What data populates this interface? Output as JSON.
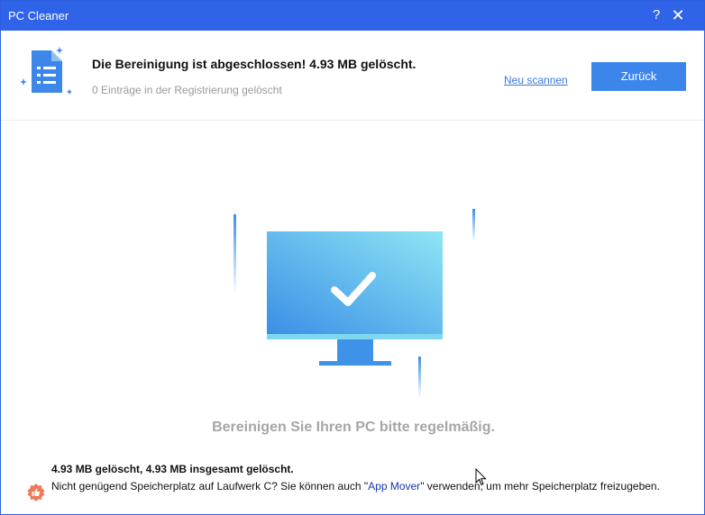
{
  "window": {
    "title": "PC Cleaner",
    "help_glyph": "?",
    "close_glyph": "✕"
  },
  "header": {
    "headline": "Die Bereinigung ist abgeschlossen! 4.93 MB gelöscht.",
    "subline": "0 Einträge in der Registrierung gelöscht",
    "rescan_label": "Neu scannen",
    "back_label": "Zurück",
    "icon": "document-sparkle-icon"
  },
  "main": {
    "illustration": "monitor-checkmark-icon",
    "hint": "Bereinigen Sie Ihren PC bitte regelmäßig."
  },
  "footer": {
    "summary": "4.93 MB gelöscht, 4.93 MB insgesamt gelöscht.",
    "notice_before": "Nicht genügend Speicherplatz auf Laufwerk C? Sie können auch \"",
    "notice_link": "App Mover",
    "notice_after": "\" verwenden, um mehr Speicherplatz freizugeben.",
    "icon": "thumbs-up-badge-icon"
  },
  "colors": {
    "titlebar": "#2f63e8",
    "accent_button": "#3c86eb",
    "link": "#3a78d8",
    "hint_text": "#a6a6a6",
    "badge": "#ee7a5a"
  }
}
